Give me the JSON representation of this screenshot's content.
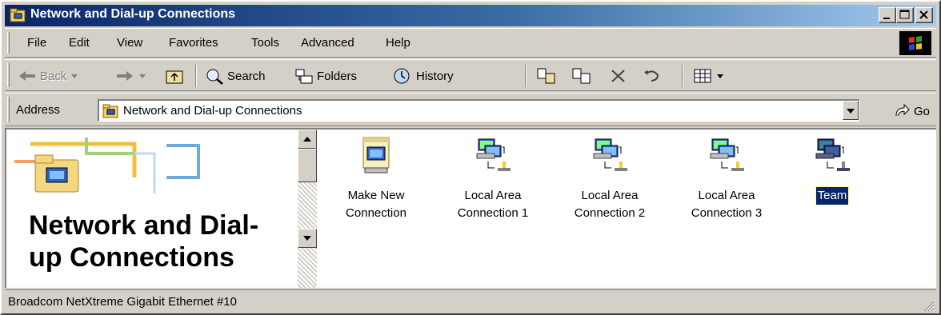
{
  "window": {
    "title": "Network and Dial-up Connections",
    "controls": {
      "minimize": "_",
      "maximize": "□",
      "close": "×"
    }
  },
  "menubar": {
    "items": [
      "File",
      "Edit",
      "View",
      "Favorites",
      "Tools",
      "Advanced",
      "Help"
    ]
  },
  "toolbar": {
    "back_label": "Back",
    "search_label": "Search",
    "folders_label": "Folders",
    "history_label": "History"
  },
  "address": {
    "label": "Address",
    "value": "Network and Dial-up Connections",
    "go_label": "Go"
  },
  "left_pane": {
    "title": "Network and Dial-up Connections"
  },
  "icons": [
    {
      "label": "Make New Connection",
      "icon": "make-new-connection-icon"
    },
    {
      "label": "Local Area Connection 1",
      "icon": "network-connection-icon"
    },
    {
      "label": "Local Area Connection 2",
      "icon": "network-connection-icon"
    },
    {
      "label": "Local Area Connection 3",
      "icon": "network-connection-icon"
    },
    {
      "label": "Team",
      "icon": "network-connection-icon",
      "selected": true
    }
  ],
  "status": {
    "text": "Broadcom NetXtreme Gigabit Ethernet #10"
  },
  "colors": {
    "title_active": "#0a246a",
    "face": "#d4d0c8",
    "selection": "#0a246a"
  }
}
